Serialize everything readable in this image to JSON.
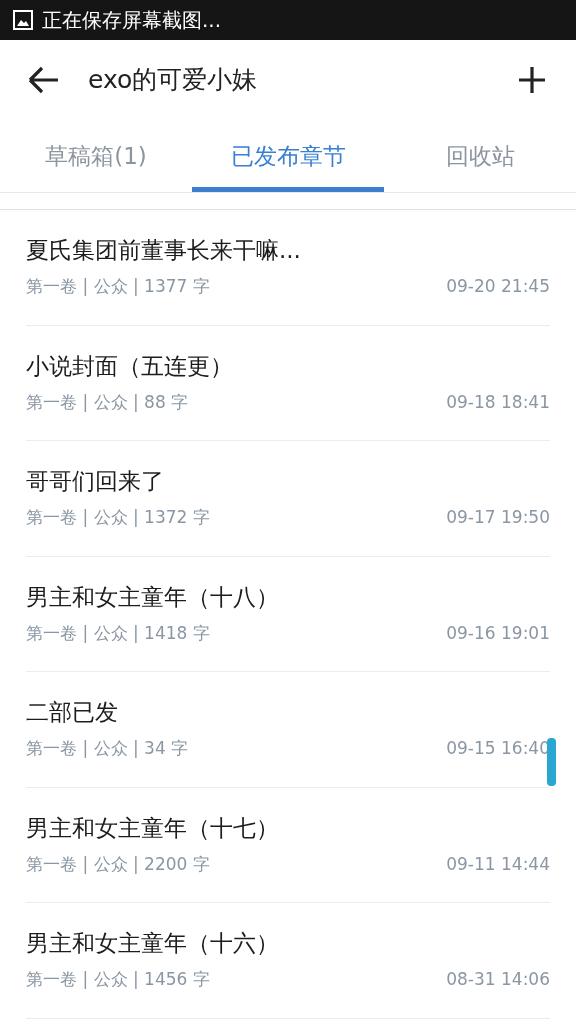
{
  "status_bar": {
    "notification": "正在保存屏幕截图..."
  },
  "app_bar": {
    "title": "exo的可爱小妹"
  },
  "tabs": [
    {
      "label": "草稿箱(1)",
      "selected": false
    },
    {
      "label": "已发布章节",
      "selected": true
    },
    {
      "label": "回收站",
      "selected": false
    }
  ],
  "chapters": [
    {
      "title": "夏氏集团前董事长来干嘛...",
      "meta": "第一卷 | 公众 | 1377 字",
      "time": "09-20 21:45"
    },
    {
      "title": "小说封面（五连更）",
      "meta": "第一卷 | 公众 | 88 字",
      "time": "09-18 18:41"
    },
    {
      "title": "哥哥们回来了",
      "meta": "第一卷 | 公众 | 1372 字",
      "time": "09-17 19:50"
    },
    {
      "title": "男主和女主童年（十八）",
      "meta": "第一卷 | 公众 | 1418 字",
      "time": "09-16 19:01"
    },
    {
      "title": "二部已发",
      "meta": "第一卷 | 公众 | 34 字",
      "time": "09-15 16:40"
    },
    {
      "title": "男主和女主童年（十七）",
      "meta": "第一卷 | 公众 | 2200 字",
      "time": "09-11 14:44"
    },
    {
      "title": "男主和女主童年（十六）",
      "meta": "第一卷 | 公众 | 1456 字",
      "time": "08-31 14:06"
    }
  ]
}
